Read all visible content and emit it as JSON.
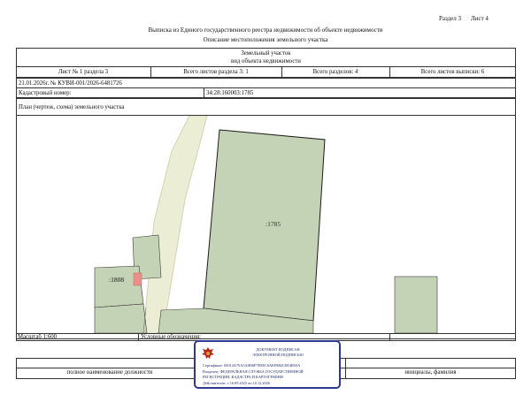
{
  "header": {
    "section": "Раздел 3",
    "sheet": "Лист 4",
    "title": "Выписка из Единого государственного реестра недвижимости об объекте недвижимости",
    "subtitle": "Описание местоположения земельного участка"
  },
  "object_table": {
    "type_value": "Земельный участок",
    "type_caption": "вид объекта недвижимости",
    "sheet_of_section": "Лист № 1 раздела 3",
    "total_section_sheets": "Всего листов раздела 3: 1",
    "total_sections": "Всего разделов: 4",
    "total_extract_sheets": "Всего листов выписки: 6"
  },
  "info": {
    "date_number": "21.01.2026г. № КУВИ-001/2026-6481726",
    "cadastral_label": "Кадастровый номер:",
    "cadastral_value": "34:28:160003:1785"
  },
  "plan": {
    "caption": "План (чертеж, схема) земельного участка",
    "main_parcel_label": ":1785",
    "left_parcel_label": ":1808",
    "colors": {
      "parcel_fill": "#c4d3b5",
      "parcel_stroke": "#1a1a1a",
      "road_fill": "#ebedd5",
      "road_stroke": "#d2d4b0",
      "marker": "#ef8c8c"
    }
  },
  "legend_row": {
    "scale": "Масштаб 1:600",
    "legend": "Условные обозначения:"
  },
  "stamp": {
    "line1": "ДОКУМЕНТ ПОДПИСАН",
    "line2": "ЭЛЕКТРОННОЙ ПОДПИСЬЮ",
    "certificate": "Сертификат: 00014A70A5A8D6F7E8EC0AEF0B2C0E4B50A",
    "owner_line1": "Владелец: ФЕДЕРАЛЬНАЯ СЛУЖБА ГОСУДАРСТВЕННОЙ",
    "owner_line2": "РЕГИСТРАЦИИ, КАДАСТРА И КАРТОГРАФИИ",
    "validity": "Действителен: с 16.09.2025 по 10.12.2026"
  },
  "footer": {
    "left": "полное наименование должности",
    "right": "инициалы, фамилия"
  }
}
